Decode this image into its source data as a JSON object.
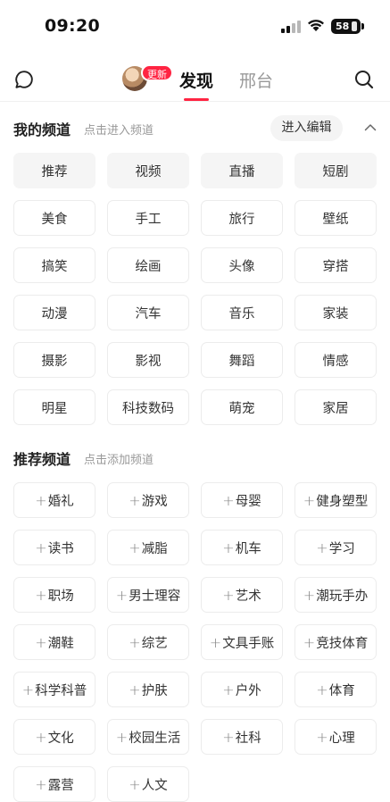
{
  "status": {
    "time": "09:20",
    "battery": "58"
  },
  "nav": {
    "badge": "更新",
    "tabs": [
      "发现",
      "邢台"
    ]
  },
  "my_channels": {
    "title": "我的频道",
    "hint": "点击进入频道",
    "edit_label": "进入编辑",
    "items": [
      "推荐",
      "视频",
      "直播",
      "短剧",
      "美食",
      "手工",
      "旅行",
      "壁纸",
      "搞笑",
      "绘画",
      "头像",
      "穿搭",
      "动漫",
      "汽车",
      "音乐",
      "家装",
      "摄影",
      "影视",
      "舞蹈",
      "情感",
      "明星",
      "科技数码",
      "萌宠",
      "家居"
    ]
  },
  "recommended_channels": {
    "title": "推荐频道",
    "hint": "点击添加频道",
    "plus": "+",
    "items": [
      "婚礼",
      "游戏",
      "母婴",
      "健身塑型",
      "读书",
      "减脂",
      "机车",
      "学习",
      "职场",
      "男士理容",
      "艺术",
      "潮玩手办",
      "潮鞋",
      "综艺",
      "文具手账",
      "竞技体育",
      "科学科普",
      "护肤",
      "户外",
      "体育",
      "文化",
      "校园生活",
      "社科",
      "心理",
      "露营",
      "人文"
    ]
  },
  "colors": {
    "accent": "#ff2442",
    "text": "#222222",
    "hint": "#999999"
  }
}
